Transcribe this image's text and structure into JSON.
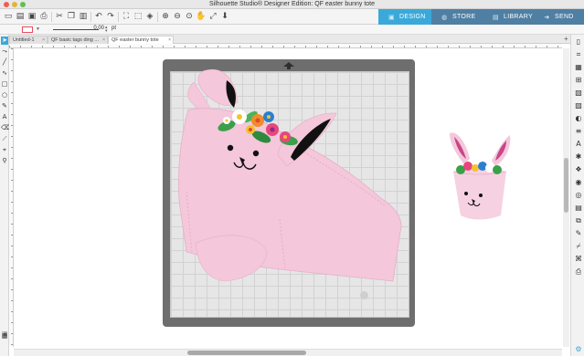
{
  "window": {
    "title": "Silhouette Studio® Designer Edition: QF easter bunny tote"
  },
  "toolbar": {
    "icons": [
      "new-document-icon",
      "open-icon",
      "save-icon",
      "print-icon",
      "cut-icon",
      "copy-icon",
      "paste-icon",
      "delete-icon",
      "undo-icon",
      "redo-icon",
      "select-all-icon",
      "deselect-icon",
      "select-by-color-icon",
      "zoom-in-icon",
      "zoom-out-icon",
      "zoom-drag-icon",
      "pan-hand-icon",
      "fit-to-page-icon",
      "move-down-icon"
    ]
  },
  "modes": {
    "design": "DESIGN",
    "store": "STORE",
    "library": "LIBRARY",
    "send": "SEND"
  },
  "line_props": {
    "color": "#e74c5a",
    "width_value": "0.00",
    "width_unit": "pt"
  },
  "tabs": [
    {
      "label": "Untitled-1"
    },
    {
      "label": "QF basic tags ding ..."
    },
    {
      "label": "QF easter bunny tote"
    }
  ],
  "colors": {
    "design_tab": "#3aa9d9",
    "mode_tabs": "#4f7fa3",
    "mat_frame": "#6e6e6e",
    "bunny_pink": "#f4c7da",
    "ear_black": "#111111"
  }
}
